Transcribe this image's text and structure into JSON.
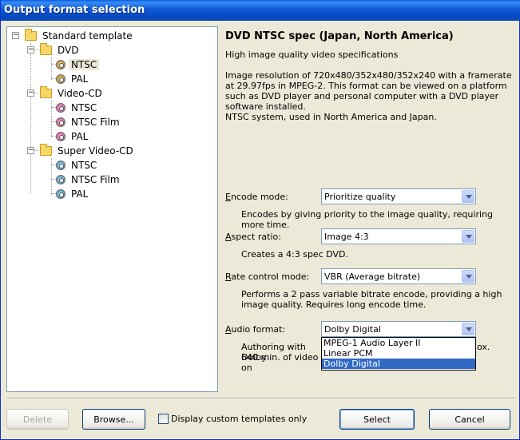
{
  "window": {
    "title": "Output format selection"
  },
  "tree": {
    "root": "Standard template",
    "groups": [
      {
        "label": "DVD",
        "items": [
          "NTSC",
          "PAL"
        ]
      },
      {
        "label": "Video-CD",
        "items": [
          "NTSC",
          "NTSC Film",
          "PAL"
        ]
      },
      {
        "label": "Super Video-CD",
        "items": [
          "NTSC",
          "NTSC Film",
          "PAL"
        ]
      }
    ]
  },
  "details": {
    "title": "DVD NTSC spec (Japan, North America)",
    "subtitle": "High image quality video specifications",
    "description": "Image resolution of 720x480/352x480/352x240 with a framerate at 29.97fps in MPEG-2. This format can be viewed on a platform such as DVD player and personal computer with a DVD player software installed.",
    "system": "NTSC system, used in North America and Japan."
  },
  "fields": {
    "encode_mode": {
      "label_key": "E",
      "label_rest": "ncode mode:",
      "value": "Prioritize quality",
      "desc": "Encodes by giving priority to the image quality, requiring more time."
    },
    "aspect_ratio": {
      "label_key": "A",
      "label_rest": "spect ratio:",
      "value": "Image 4:3",
      "desc": "Creates a 4:3 spec DVD."
    },
    "rate_control": {
      "label_key": "R",
      "label_rest": "ate control mode:",
      "value": "VBR (Average bitrate)",
      "desc": "Performs a 2 pass variable bitrate encode, providing a high image quality. Requires long encode time."
    },
    "audio_format": {
      "label_key": "A",
      "label_rest": "udio format:",
      "value": "Dolby Digital",
      "desc_line1_left": "Authoring with Dolby",
      "desc_line1_right": "ox.",
      "desc_line2_left": "640 min. of video on",
      "options": [
        "MPEG-1 Audio Layer II",
        "Linear PCM",
        "Dolby Digital"
      ]
    }
  },
  "buttons": {
    "delete": "Delete",
    "browse": "Browse...",
    "custom_only": "Display custom templates only",
    "select": "Select",
    "cancel": "Cancel"
  }
}
